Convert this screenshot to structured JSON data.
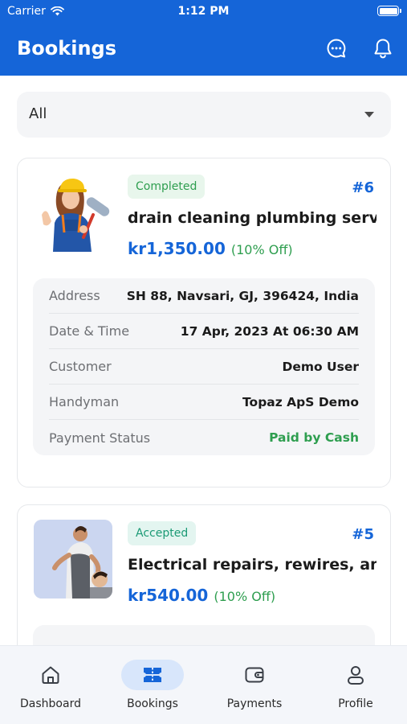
{
  "status_bar": {
    "carrier": "Carrier",
    "time": "1:12 PM"
  },
  "header": {
    "title": "Bookings",
    "icons": [
      "chat-icon",
      "bell-icon"
    ]
  },
  "filter": {
    "selected": "All"
  },
  "bookings": [
    {
      "status": "Completed",
      "id": "#6",
      "service": "drain cleaning plumbing service",
      "price": "kr1,350.00",
      "discount": "(10% Off)",
      "details": [
        {
          "label": "Address",
          "value": "SH 88, Navsari, GJ, 396424, India"
        },
        {
          "label": "Date & Time",
          "value": "17 Apr, 2023 At 06:30 AM"
        },
        {
          "label": "Customer",
          "value": "Demo User"
        },
        {
          "label": "Handyman",
          "value": "Topaz ApS Demo"
        },
        {
          "label": "Payment Status",
          "value": "Paid by Cash"
        }
      ]
    },
    {
      "status": "Accepted",
      "id": "#5",
      "service": "Electrical repairs, rewires, and installations",
      "price": "kr540.00",
      "discount": "(10% Off)"
    }
  ],
  "nav": {
    "items": [
      {
        "label": "Dashboard",
        "icon": "home-icon"
      },
      {
        "label": "Bookings",
        "icon": "ticket-icon"
      },
      {
        "label": "Payments",
        "icon": "wallet-icon"
      },
      {
        "label": "Profile",
        "icon": "profile-icon"
      }
    ],
    "active": "Bookings"
  },
  "colors": {
    "primary": "#1565d8",
    "success": "#2e9e4f",
    "surface": "#f4f5f7"
  }
}
